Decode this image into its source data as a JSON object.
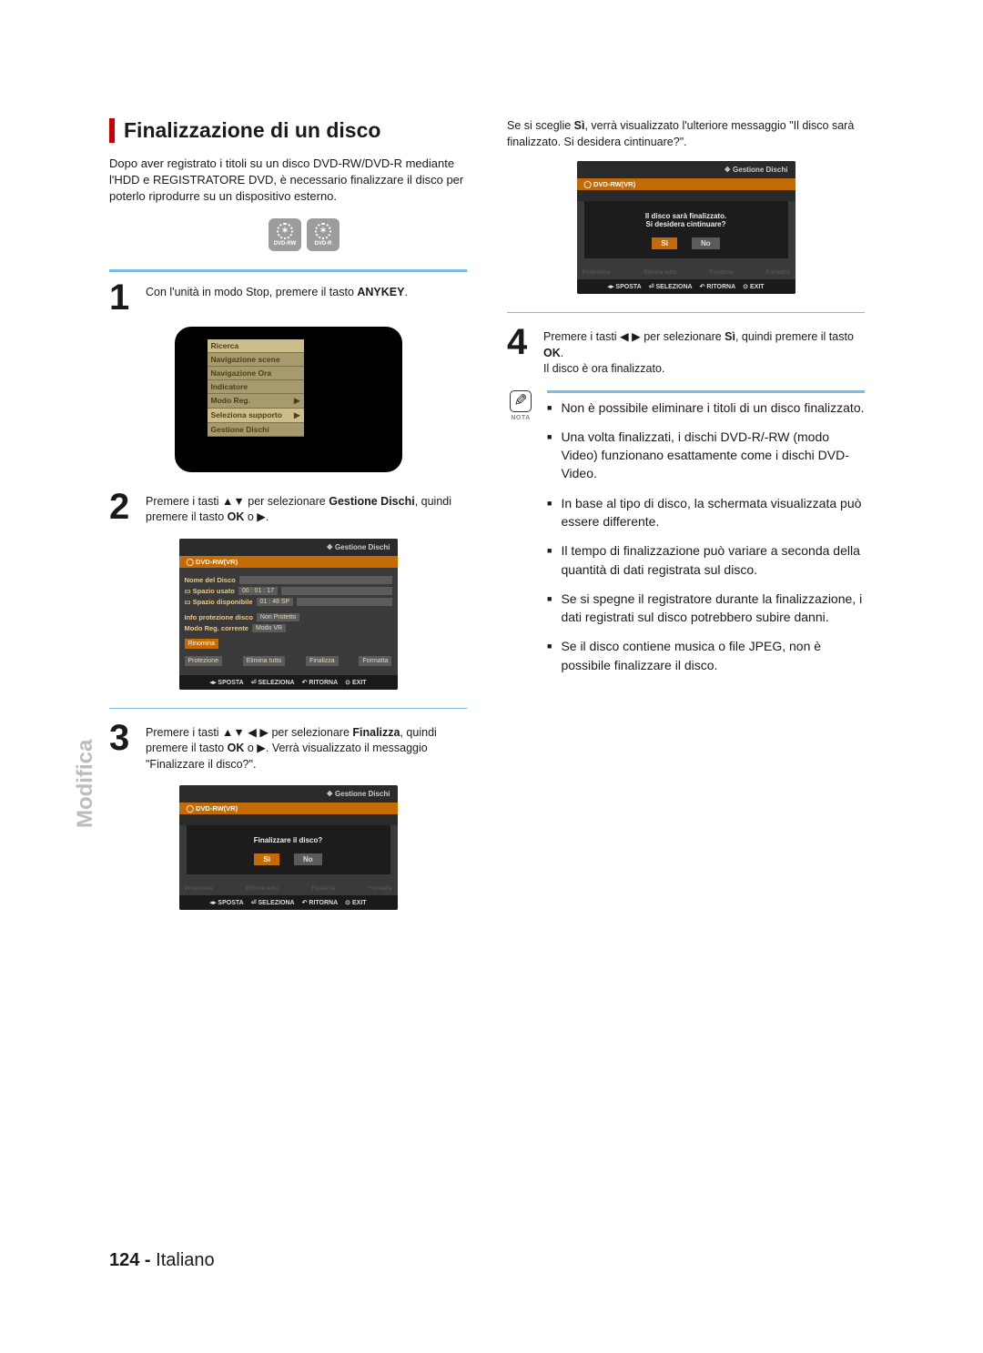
{
  "section_title": "Finalizzazione di un disco",
  "intro": "Dopo aver registrato i titoli su un disco DVD-RW/DVD-R mediante l'HDD e REGISTRATORE DVD, è necessario finalizzare il disco per poterlo riprodurre su un dispositivo esterno.",
  "disc_labels": [
    "DVD-RW",
    "DVD-R"
  ],
  "step1": {
    "num": "1",
    "text_a": "Con l'unità in modo Stop, premere il tasto ",
    "bold": "ANYKEY",
    "text_b": "."
  },
  "menu": {
    "items": [
      "Ricerca",
      "Navigazione scene",
      "Navigazione Ora",
      "Indicatore",
      "Modo Reg.",
      "Seleziona supporto",
      "Gestione Dischi"
    ]
  },
  "step2": {
    "num": "2",
    "a": "Premere i tasti ▲▼ per selezionare ",
    "bold": "Gestione Dischi",
    "b": ", quindi premere il tasto ",
    "bold2": "OK",
    "c": " o ▶."
  },
  "screen2": {
    "header": "Gestione Dischi",
    "sub": "DVD-RW(VR)",
    "name_label": "Nome del Disco",
    "used_label": "Spazio usato",
    "used_val": "00 : 01 : 17",
    "avail_label": "Spazio disponibile",
    "avail_val": "01 : 48 SP",
    "prot_label": "Info protezione disco",
    "prot_val": "Non Protetto",
    "mode_label": "Modo Reg. corrente",
    "mode_val": "Modo VR",
    "buttons": {
      "rename": "Rinomina",
      "prot": "Protezione",
      "delall": "Elimina tutto",
      "final": "Finalizza",
      "format": "Formatta"
    }
  },
  "bottombar": {
    "move": "SPOSTA",
    "select": "SELEZIONA",
    "return": "RITORNA",
    "exit": "EXIT"
  },
  "step3": {
    "num": "3",
    "a": "Premere i tasti ▲▼ ◀ ▶ per selezionare ",
    "bold": "Finalizza",
    "b": ", quindi premere il tasto ",
    "bold2": "OK",
    "c": " o ▶. Verrà visualizzato il messaggio \"Finalizzare il disco?\"."
  },
  "dialog3": {
    "q": "Finalizzare il disco?",
    "si": "Sì",
    "no": "No"
  },
  "col2_intro_a": "Se si sceglie ",
  "col2_intro_bold": "Sì",
  "col2_intro_b": ", verrà visualizzato l'ulteriore messaggio \"Il disco sarà finalizzato. Si desidera cintinuare?\".",
  "dialog4": {
    "l1": "Il disco sarà finalizzato.",
    "l2": "Si desidera cintinuare?",
    "si": "Sì",
    "no": "No"
  },
  "step4": {
    "num": "4",
    "a": "Premere i tasti ◀ ▶ per selezionare ",
    "bold": "Sì",
    "b": ", quindi premere il tasto ",
    "bold2": "OK",
    "c": ".",
    "after": "Il disco è ora finalizzato."
  },
  "note_label": "NOTA",
  "notes": [
    "Non è possibile eliminare i titoli di un disco finalizzato.",
    "Una volta finalizzati, i dischi DVD-R/-RW (modo Video) funzionano esattamente come i dischi DVD-Video.",
    "In base al tipo di disco, la schermata visualizzata può essere differente.",
    "Il tempo di finalizzazione può variare a seconda della quantità di dati registrata sul disco.",
    "Se si spegne il registratore durante la finalizzazione, i dati registrati sul disco potrebbero subire danni.",
    "Se il disco contiene musica o file JPEG, non è possibile finalizzare il disco."
  ],
  "sidetab": "Modifica",
  "footer": {
    "page": "124 -",
    "lang": " Italiano"
  },
  "icons": {
    "diamond": "❖",
    "enter": "⏎",
    "ret": "↶",
    "exit": "⊙",
    "arrows": "◂▸"
  }
}
